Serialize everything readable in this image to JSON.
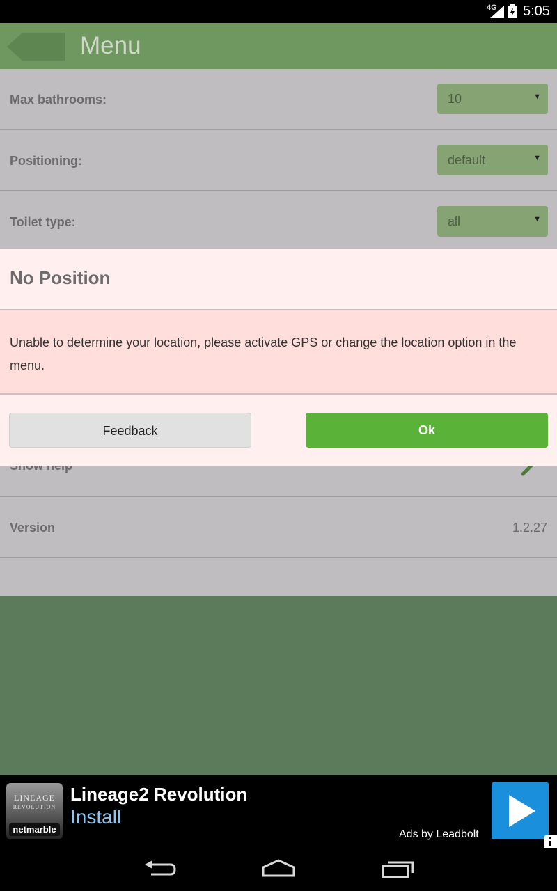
{
  "status_bar": {
    "network": "4G",
    "time": "5:05"
  },
  "app_bar": {
    "title": "Menu",
    "back_icon": "back-arrow-icon"
  },
  "menu": {
    "rows": [
      {
        "label": "Max bathrooms:",
        "value": "10"
      },
      {
        "label": "Positioning:",
        "value": "default"
      },
      {
        "label": "Toilet type:",
        "value": "all"
      }
    ],
    "show_help_label": "Show help",
    "version_label": "Version",
    "version_value": "1.2.27"
  },
  "dialog": {
    "title": "No Position",
    "message": "Unable to determine your location, please activate GPS or change the location option in the menu.",
    "feedback_label": "Feedback",
    "ok_label": "Ok"
  },
  "ad": {
    "icon_text_line1": "LINEAGE",
    "icon_text_line2": "REVOLUTION",
    "icon_brand": "netmarble",
    "title": "Lineage2 Revolution",
    "cta": "Install",
    "provider": "Ads by Leadbolt"
  },
  "colors": {
    "app_bar": "#6f9760",
    "ok_button": "#5bb239",
    "dialog_header": "#fff0ef",
    "dialog_body": "#ffdedc",
    "ad_play": "#1a8fdc"
  }
}
